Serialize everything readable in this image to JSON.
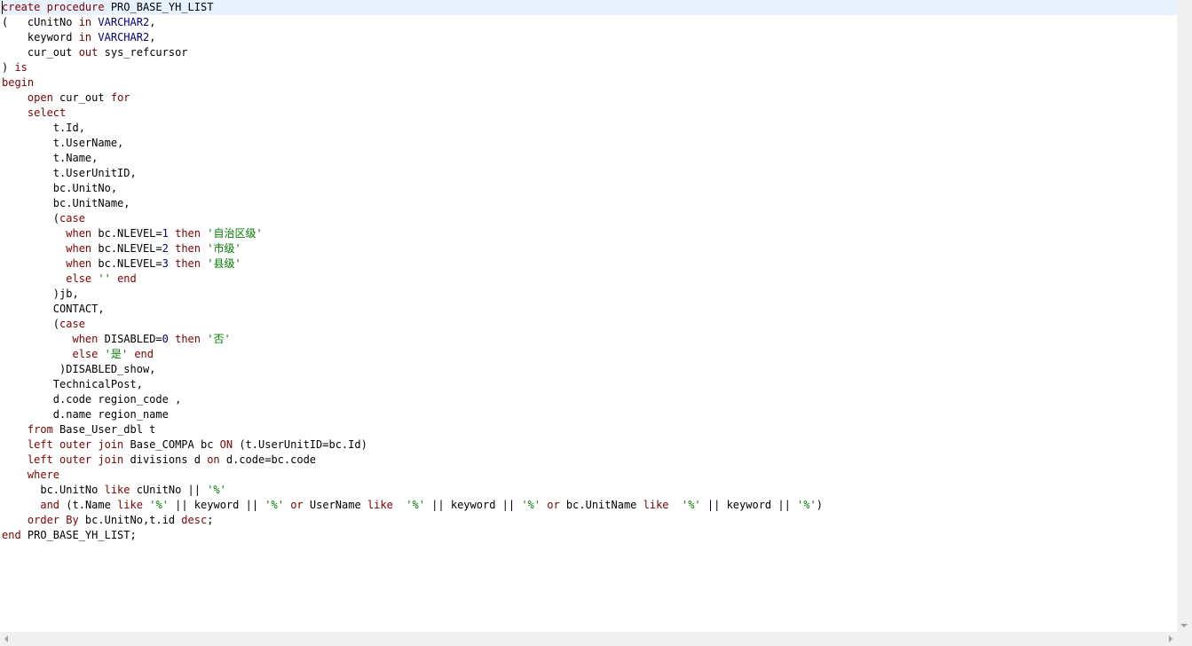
{
  "editor": {
    "lines": [
      [
        {
          "t": "create procedure",
          "c": "kw"
        },
        {
          "t": " PRO_BASE_YH_LIST",
          "c": "pl"
        }
      ],
      [
        {
          "t": "(   cUnitNo ",
          "c": "pl"
        },
        {
          "t": "in",
          "c": "kw"
        },
        {
          "t": " ",
          "c": "pl"
        },
        {
          "t": "VARCHAR2",
          "c": "ty"
        },
        {
          "t": ",",
          "c": "pl"
        }
      ],
      [
        {
          "t": "    keyword ",
          "c": "pl"
        },
        {
          "t": "in",
          "c": "kw"
        },
        {
          "t": " ",
          "c": "pl"
        },
        {
          "t": "VARCHAR2",
          "c": "ty"
        },
        {
          "t": ",",
          "c": "pl"
        }
      ],
      [
        {
          "t": "    cur_out ",
          "c": "pl"
        },
        {
          "t": "out",
          "c": "kw"
        },
        {
          "t": " sys_refcursor",
          "c": "pl"
        }
      ],
      [
        {
          "t": ") ",
          "c": "pl"
        },
        {
          "t": "is",
          "c": "kw"
        }
      ],
      [
        {
          "t": "begin",
          "c": "kw"
        }
      ],
      [
        {
          "t": "    ",
          "c": "pl"
        },
        {
          "t": "open",
          "c": "kw"
        },
        {
          "t": " cur_out ",
          "c": "pl"
        },
        {
          "t": "for",
          "c": "kw"
        }
      ],
      [
        {
          "t": "    ",
          "c": "pl"
        },
        {
          "t": "select",
          "c": "kw"
        }
      ],
      [
        {
          "t": "        t.Id,",
          "c": "pl"
        }
      ],
      [
        {
          "t": "        t.UserName,",
          "c": "pl"
        }
      ],
      [
        {
          "t": "        t.Name,",
          "c": "pl"
        }
      ],
      [
        {
          "t": "        t.UserUnitID,",
          "c": "pl"
        }
      ],
      [
        {
          "t": "        bc.UnitNo,",
          "c": "pl"
        }
      ],
      [
        {
          "t": "        bc.UnitName,",
          "c": "pl"
        }
      ],
      [
        {
          "t": "        (",
          "c": "pl"
        },
        {
          "t": "case",
          "c": "kw"
        }
      ],
      [
        {
          "t": "          ",
          "c": "pl"
        },
        {
          "t": "when",
          "c": "kw"
        },
        {
          "t": " bc.NLEVEL=",
          "c": "pl"
        },
        {
          "t": "1",
          "c": "num"
        },
        {
          "t": " ",
          "c": "pl"
        },
        {
          "t": "then",
          "c": "kw"
        },
        {
          "t": " ",
          "c": "pl"
        },
        {
          "t": "'自治区级'",
          "c": "str"
        }
      ],
      [
        {
          "t": "          ",
          "c": "pl"
        },
        {
          "t": "when",
          "c": "kw"
        },
        {
          "t": " bc.NLEVEL=",
          "c": "pl"
        },
        {
          "t": "2",
          "c": "num"
        },
        {
          "t": " ",
          "c": "pl"
        },
        {
          "t": "then",
          "c": "kw"
        },
        {
          "t": " ",
          "c": "pl"
        },
        {
          "t": "'市级'",
          "c": "str"
        }
      ],
      [
        {
          "t": "          ",
          "c": "pl"
        },
        {
          "t": "when",
          "c": "kw"
        },
        {
          "t": " bc.NLEVEL=",
          "c": "pl"
        },
        {
          "t": "3",
          "c": "num"
        },
        {
          "t": " ",
          "c": "pl"
        },
        {
          "t": "then",
          "c": "kw"
        },
        {
          "t": " ",
          "c": "pl"
        },
        {
          "t": "'县级'",
          "c": "str"
        }
      ],
      [
        {
          "t": "          ",
          "c": "pl"
        },
        {
          "t": "else",
          "c": "kw"
        },
        {
          "t": " ",
          "c": "pl"
        },
        {
          "t": "''",
          "c": "str"
        },
        {
          "t": " ",
          "c": "pl"
        },
        {
          "t": "end",
          "c": "kw"
        }
      ],
      [
        {
          "t": "        )jb,",
          "c": "pl"
        }
      ],
      [
        {
          "t": "        CONTACT,",
          "c": "pl"
        }
      ],
      [
        {
          "t": "        (",
          "c": "pl"
        },
        {
          "t": "case",
          "c": "kw"
        }
      ],
      [
        {
          "t": "           ",
          "c": "pl"
        },
        {
          "t": "when",
          "c": "kw"
        },
        {
          "t": " DISABLED=",
          "c": "pl"
        },
        {
          "t": "0",
          "c": "num"
        },
        {
          "t": " ",
          "c": "pl"
        },
        {
          "t": "then",
          "c": "kw"
        },
        {
          "t": " ",
          "c": "pl"
        },
        {
          "t": "'否'",
          "c": "str"
        }
      ],
      [
        {
          "t": "           ",
          "c": "pl"
        },
        {
          "t": "else",
          "c": "kw"
        },
        {
          "t": " ",
          "c": "pl"
        },
        {
          "t": "'是'",
          "c": "str"
        },
        {
          "t": " ",
          "c": "pl"
        },
        {
          "t": "end",
          "c": "kw"
        }
      ],
      [
        {
          "t": "         )DISABLED_show,",
          "c": "pl"
        }
      ],
      [
        {
          "t": "        TechnicalPost,",
          "c": "pl"
        }
      ],
      [
        {
          "t": "        d.code region_code ,",
          "c": "pl"
        }
      ],
      [
        {
          "t": "        d.name region_name",
          "c": "pl"
        }
      ],
      [
        {
          "t": "    ",
          "c": "pl"
        },
        {
          "t": "from",
          "c": "kw"
        },
        {
          "t": " Base_User_dbl t",
          "c": "pl"
        }
      ],
      [
        {
          "t": "    ",
          "c": "pl"
        },
        {
          "t": "left outer join",
          "c": "kw"
        },
        {
          "t": " Base_COMPA bc ",
          "c": "pl"
        },
        {
          "t": "ON",
          "c": "kw"
        },
        {
          "t": " (t.UserUnitID=bc.Id)",
          "c": "pl"
        }
      ],
      [
        {
          "t": "    ",
          "c": "pl"
        },
        {
          "t": "left outer join",
          "c": "kw"
        },
        {
          "t": " divisions d ",
          "c": "pl"
        },
        {
          "t": "on",
          "c": "kw"
        },
        {
          "t": " d.code=bc.code",
          "c": "pl"
        }
      ],
      [
        {
          "t": "    ",
          "c": "pl"
        },
        {
          "t": "where",
          "c": "kw"
        }
      ],
      [
        {
          "t": "      bc.UnitNo ",
          "c": "pl"
        },
        {
          "t": "like",
          "c": "kw"
        },
        {
          "t": " cUnitNo || ",
          "c": "pl"
        },
        {
          "t": "'%'",
          "c": "str"
        }
      ],
      [
        {
          "t": "      ",
          "c": "pl"
        },
        {
          "t": "and",
          "c": "kw"
        },
        {
          "t": " (t.Name ",
          "c": "pl"
        },
        {
          "t": "like",
          "c": "kw"
        },
        {
          "t": " ",
          "c": "pl"
        },
        {
          "t": "'%'",
          "c": "str"
        },
        {
          "t": " || keyword || ",
          "c": "pl"
        },
        {
          "t": "'%'",
          "c": "str"
        },
        {
          "t": " ",
          "c": "pl"
        },
        {
          "t": "or",
          "c": "kw"
        },
        {
          "t": " UserName ",
          "c": "pl"
        },
        {
          "t": "like",
          "c": "kw"
        },
        {
          "t": "  ",
          "c": "pl"
        },
        {
          "t": "'%'",
          "c": "str"
        },
        {
          "t": " || keyword || ",
          "c": "pl"
        },
        {
          "t": "'%'",
          "c": "str"
        },
        {
          "t": " ",
          "c": "pl"
        },
        {
          "t": "or",
          "c": "kw"
        },
        {
          "t": " bc.UnitName ",
          "c": "pl"
        },
        {
          "t": "like",
          "c": "kw"
        },
        {
          "t": "  ",
          "c": "pl"
        },
        {
          "t": "'%'",
          "c": "str"
        },
        {
          "t": " || keyword || ",
          "c": "pl"
        },
        {
          "t": "'%'",
          "c": "str"
        },
        {
          "t": ")",
          "c": "pl"
        }
      ],
      [
        {
          "t": "    ",
          "c": "pl"
        },
        {
          "t": "order By",
          "c": "kw"
        },
        {
          "t": " bc.UnitNo,t.id ",
          "c": "pl"
        },
        {
          "t": "desc",
          "c": "kw"
        },
        {
          "t": ";",
          "c": "pl"
        }
      ],
      [
        {
          "t": "end",
          "c": "kw"
        },
        {
          "t": " PRO_BASE_YH_LIST;",
          "c": "pl"
        }
      ]
    ]
  },
  "colors": {
    "keyword": "#800000",
    "type": "#000080",
    "string": "#008000",
    "current_line": "#e8f2fe"
  },
  "icons": {
    "vscroll_down": "chevron-down-icon",
    "hscroll_left": "chevron-left-icon",
    "hscroll_right": "chevron-right-icon"
  }
}
